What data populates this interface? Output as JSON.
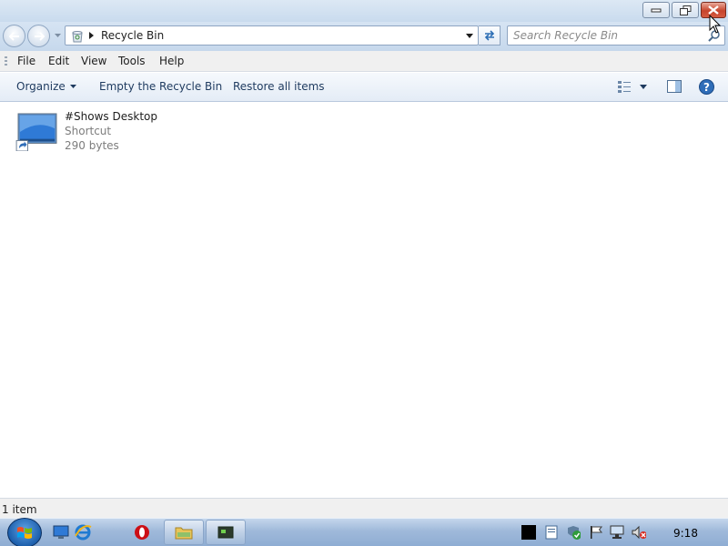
{
  "address": {
    "crumb": "Recycle Bin"
  },
  "search": {
    "placeholder": "Search Recycle Bin"
  },
  "menu": {
    "file": "File",
    "edit": "Edit",
    "view": "View",
    "tools": "Tools",
    "help": "Help"
  },
  "commands": {
    "organize": "Organize",
    "empty": "Empty the Recycle Bin",
    "restore": "Restore all items"
  },
  "items": [
    {
      "name": "#Shows Desktop",
      "type": "Shortcut",
      "size": "290 bytes",
      "icon": "desktop-shortcut-icon"
    }
  ],
  "status": {
    "count": "1 item"
  },
  "taskbar": {
    "time": "9:18"
  },
  "colors": {
    "close_button": "#c7442c",
    "taskbar": "#9fb9da",
    "accent": "#1c5eab"
  }
}
